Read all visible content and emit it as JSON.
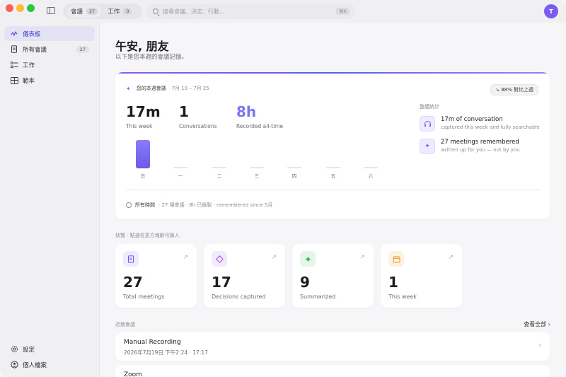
{
  "tabs": [
    {
      "label": "會議",
      "count": "27"
    },
    {
      "label": "工作",
      "count": "0"
    }
  ],
  "search": {
    "placeholder": "搜尋會議、決定、行動...",
    "shortcut": "⌘K"
  },
  "avatar": {
    "initial": "T",
    "color": "#7c5cf0"
  },
  "sidebar": {
    "items": [
      {
        "label": "儀表板",
        "icon": "sparkle-icon"
      },
      {
        "label": "所有會議",
        "icon": "document-icon",
        "count": "27"
      },
      {
        "label": "工作",
        "icon": "checklist-icon"
      },
      {
        "label": "範本",
        "icon": "template-icon"
      }
    ],
    "footer": [
      {
        "label": "設定",
        "icon": "gear-icon"
      },
      {
        "label": "個人檔案",
        "icon": "user-icon"
      }
    ]
  },
  "main": {
    "greeting": "午安, 朋友",
    "subtitle": "以下是您本週的會議記憶。",
    "week": {
      "title": "您的本週會議",
      "range": "7月 19 – 7月 25",
      "compare": "↘ 88% 對比上週",
      "stats": [
        {
          "value": "17m",
          "label": "This week"
        },
        {
          "value": "1",
          "label": "Conversations"
        },
        {
          "value": "8h",
          "label": "Recorded all-time"
        }
      ],
      "days": [
        {
          "label": "日",
          "level": 1
        },
        {
          "label": "一",
          "level": 0
        },
        {
          "label": "二",
          "level": 0
        },
        {
          "label": "三",
          "level": 0
        },
        {
          "label": "四",
          "level": 0
        },
        {
          "label": "五",
          "level": 0
        },
        {
          "label": "六",
          "level": 0
        }
      ],
      "alltime_label": "所有時間",
      "alltime_detail": "· 27 場會議 · 8h 已錄製 · remembered since 5月",
      "highlights_title": "整體統計",
      "highlights": [
        {
          "main": "17m of conversation",
          "sub": "captured this week and fully searchable",
          "icon": "headphones-icon"
        },
        {
          "main": "27 meetings remembered",
          "sub": "written up for you — not by you",
          "icon": "sparkle-icon"
        }
      ]
    },
    "quick_title": "快覽 · 點選任意方塊即可篩入",
    "quick_cards": [
      {
        "value": "27",
        "label": "Total meetings",
        "icon": "document-icon",
        "color": "#6b5ae8",
        "bg": "#efeafd"
      },
      {
        "value": "17",
        "label": "Decisions captured",
        "icon": "diamond-icon",
        "color": "#a05ce8",
        "bg": "#f3eafd"
      },
      {
        "value": "9",
        "label": "Summarized",
        "icon": "sparkle-icon",
        "color": "#2fb85a",
        "bg": "#e6f7ea"
      },
      {
        "value": "1",
        "label": "This week",
        "icon": "calendar-icon",
        "color": "#e89a2f",
        "bg": "#fdf1e0"
      }
    ],
    "recent_title": "近期會議",
    "view_all": "查看全部 ›",
    "recent": [
      {
        "title": "Manual Recording",
        "date": "2026年7月19日 下午2:24 · 17:17"
      },
      {
        "title": "Zoom",
        "date": ""
      }
    ]
  }
}
